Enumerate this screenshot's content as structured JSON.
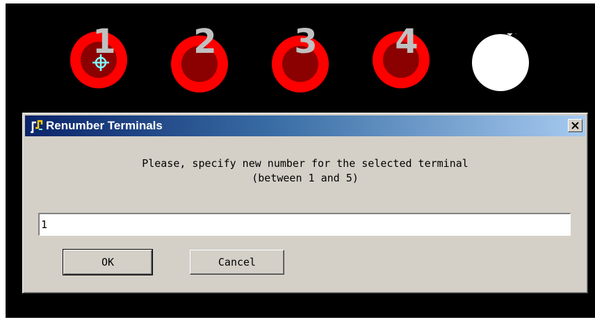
{
  "canvas": {
    "pads": [
      {
        "number": "1",
        "selected": true
      },
      {
        "number": "2",
        "selected": false
      },
      {
        "number": "3",
        "selected": false
      },
      {
        "number": "4",
        "selected": false
      },
      {
        "number": "",
        "selected": false
      }
    ],
    "colors": {
      "background": "#000000",
      "pad_ring": "#ff0000",
      "pad_hole": "#8b0000",
      "number": "#c0c0c0",
      "selection_marker": "#7fffff",
      "last_pad": "#ffffff"
    }
  },
  "dialog": {
    "title": "Renumber Terminals",
    "close_label": "×",
    "message_line1": "Please, specify new number for the selected terminal",
    "message_line2": "(between 1 and 5)",
    "input_value": "1",
    "ok_label": "OK",
    "cancel_label": "Cancel"
  }
}
